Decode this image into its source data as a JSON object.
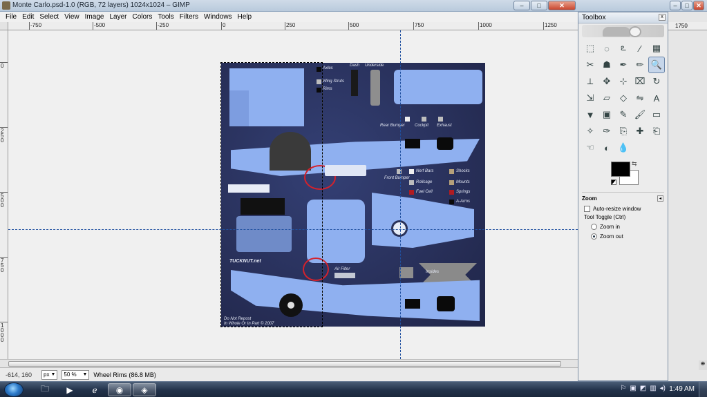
{
  "window": {
    "title": "Monte Carlo.psd-1.0 (RGB, 72 layers) 1024x1024 – GIMP",
    "minimize": "–",
    "maximize": "□",
    "close": "✕"
  },
  "menu": [
    "File",
    "Edit",
    "Select",
    "View",
    "Image",
    "Layer",
    "Colors",
    "Tools",
    "Filters",
    "Windows",
    "Help"
  ],
  "ruler": {
    "h_labels": [
      "-750",
      "-500",
      "-250",
      "0",
      "250",
      "500",
      "750",
      "1000",
      "1250"
    ],
    "v_labels": [
      "0",
      "250",
      "500",
      "750",
      "1000"
    ],
    "right_label": "1750"
  },
  "image_labels": {
    "axles": "Axles",
    "wing_struts": "Wing Struts",
    "rims": "Rims",
    "dash": "Dash",
    "underside": "Underside",
    "rear_bumper": "Rear Bumper",
    "cockpit": "Cockpit",
    "exhaust": "Exhaust",
    "nerf_bars": "Nerf Bars",
    "front_bumper": "Front Bumper",
    "rollcage": "Rollcage",
    "fuel_cell": "Fuel Cell",
    "shocks": "Shocks",
    "mounts": "Mounts",
    "springs": "Springs",
    "a_arms": "A-Arms",
    "air_filter": "Air Filter",
    "insides": "Insides",
    "tucknut": "TUCKNUT.net",
    "disclaimer1": "Do Not Repost",
    "disclaimer2": "In Whole Or In Part © 2007"
  },
  "swatch_colors": {
    "grey": "#bdbdbd",
    "tan": "#b5a07a",
    "red": "#b01c22",
    "black": "#0a0a0a",
    "white": "#efefef",
    "part_blue": "#8fb0f0"
  },
  "statusbar": {
    "coords": "-614, 160",
    "unit": "px",
    "zoom": "50 %",
    "message": "Wheel Rims (86.8 MB)"
  },
  "toolbox": {
    "title": "Toolbox",
    "close": "x",
    "tools": [
      "rect-select",
      "ellipse-select",
      "lasso",
      "fuzzy-select",
      "by-color-select",
      "scissors",
      "foreground-select",
      "paths",
      "color-picker",
      "zoom",
      "measure",
      "move",
      "align",
      "crop",
      "rotate",
      "scale",
      "shear",
      "perspective",
      "flip",
      "text",
      "bucket-fill",
      "blend",
      "pencil",
      "paintbrush",
      "eraser",
      "airbrush",
      "ink",
      "clone",
      "heal",
      "perspective-clone",
      "smudge",
      "dodge-burn",
      "blur"
    ],
    "tool_glyphs": [
      "⬚",
      "◌",
      "ఽ",
      "⁄",
      "▦",
      "✂",
      "☗",
      "✒",
      "✏",
      "🔍",
      "⟂",
      "✥",
      "⊹",
      "⌧",
      "↻",
      "⇲",
      "▱",
      "◇",
      "⇋",
      "A",
      "▼",
      "▣",
      "✎",
      "🖌",
      "▭",
      "✧",
      "✑",
      "⎘",
      "✚",
      "⎗",
      "☜",
      "◐",
      "💧"
    ],
    "selected_tool": "zoom",
    "fg_color": "#000000",
    "bg_color": "#ffffff",
    "options_title": "Zoom",
    "auto_resize": "Auto-resize window",
    "toggle_label": "Tool Toggle  (Ctrl)",
    "zoom_in": "Zoom in",
    "zoom_out": "Zoom out"
  },
  "taskbar": {
    "time": "1:49 AM",
    "apps": [
      "explorer",
      "media",
      "ie",
      "firefox",
      "gimp"
    ]
  }
}
